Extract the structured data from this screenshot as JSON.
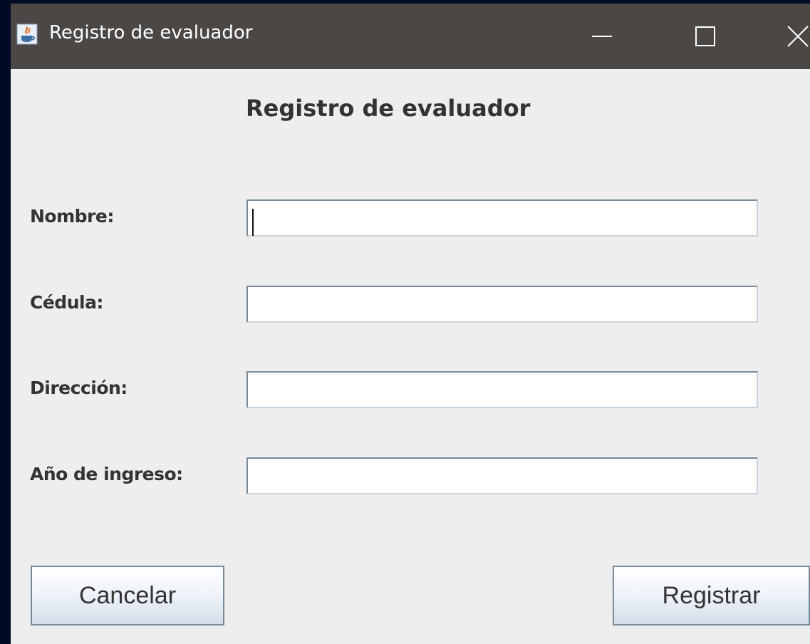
{
  "window": {
    "title": "Registro de evaluador",
    "controls": {
      "minimize_icon": "minimize-icon",
      "maximize_icon": "maximize-icon",
      "close_icon": "close-icon"
    },
    "colors": {
      "titlebar": "#4a4745",
      "body": "#eeeeee",
      "desktop": "#000a23"
    }
  },
  "form": {
    "heading": "Registro de evaluador",
    "fields": [
      {
        "label": "Nombre:",
        "value": ""
      },
      {
        "label": "Cédula:",
        "value": ""
      },
      {
        "label": "Dirección:",
        "value": ""
      },
      {
        "label": "Año de ingreso:",
        "value": ""
      }
    ]
  },
  "buttons": {
    "cancel_label": "Cancelar",
    "register_label": "Registrar"
  }
}
